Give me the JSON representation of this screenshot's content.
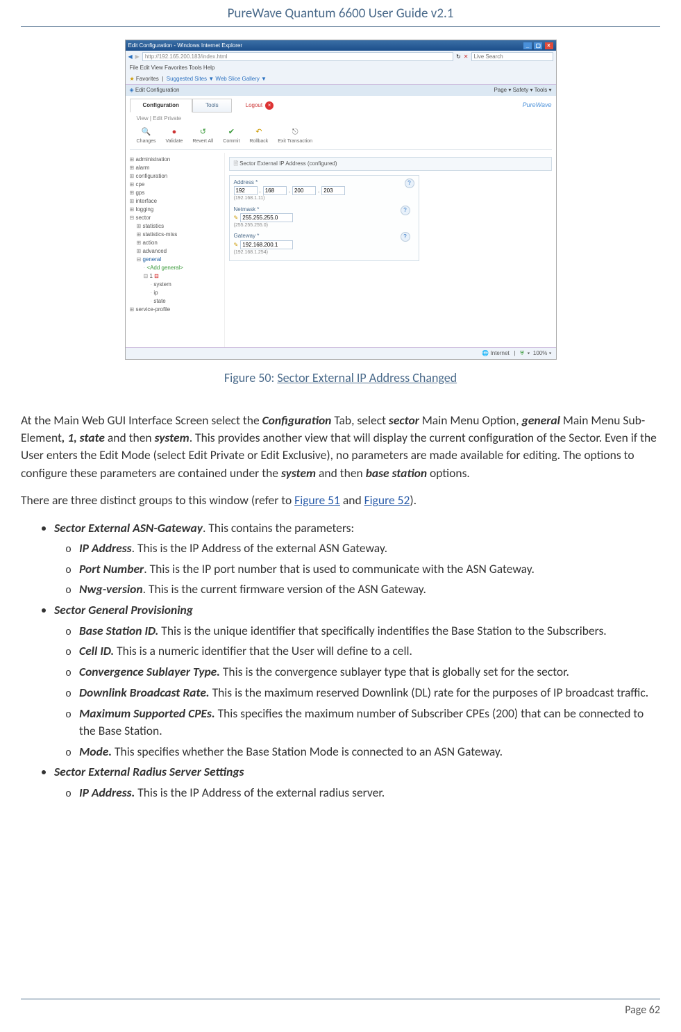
{
  "header": {
    "title": "PureWave Quantum 6600 User Guide v2.1"
  },
  "footer": {
    "page_label": "Page 62"
  },
  "screenshot": {
    "window_title": "Edit Configuration - Windows Internet Explorer",
    "address": "http://192.165.200.183/index.html",
    "search_placeholder": "Live Search",
    "menu": "File   Edit   View   Favorites   Tools   Help",
    "favorites_label": "Favorites",
    "fav_links": "Suggested Sites ▼  Web Slice Gallery ▼",
    "tab_title": "Edit Configuration",
    "tab_tools": "Page ▾ Safety ▾ Tools ▾",
    "tabs": {
      "configuration": "Configuration",
      "tools": "Tools",
      "logout": "Logout"
    },
    "logo": "PureWave",
    "subbar": "View  |  Edit Private",
    "toolbar": [
      {
        "icon": "🔍",
        "label": "Changes",
        "color": "#2a70c0"
      },
      {
        "icon": "●",
        "label": "Validate",
        "color": "#c33"
      },
      {
        "icon": "↺",
        "label": "Revert All",
        "color": "#3a9a3a"
      },
      {
        "icon": "✔",
        "label": "Commit",
        "color": "#3a9a3a"
      },
      {
        "icon": "↶",
        "label": "Rollback",
        "color": "#c90"
      },
      {
        "icon": "⎋",
        "label": "Exit Transaction",
        "color": "#888"
      }
    ],
    "tree": {
      "administration": "administration",
      "alarm": "alarm",
      "configuration": "configuration",
      "cpe": "cpe",
      "gps": "gps",
      "interface": "interface",
      "logging": "logging",
      "sector": "sector",
      "statistics": "statistics",
      "statistics_miss": "statistics-miss",
      "action": "action",
      "advanced": "advanced",
      "general": "general",
      "add_general": "<Add general>",
      "one": "1",
      "system": "system",
      "ip": "ip",
      "state": "state",
      "service_profile": "service-profile"
    },
    "panel_title": "Sector External IP Address (configured)",
    "form": {
      "address_label": "Address *",
      "addr_octets": [
        "192",
        "168",
        "200",
        "203"
      ],
      "addr_hint": "(192.168.1.11)",
      "netmask_label": "Netmask *",
      "netmask_value": "255.255.255.0",
      "netmask_hint": "(255.255.255.0)",
      "gateway_label": "Gateway *",
      "gateway_value": "192.168.200.1",
      "gateway_hint": "(192.168.1.254)"
    },
    "status": {
      "internet": "Internet",
      "zoom": "100%"
    }
  },
  "figure": {
    "prefix": "Figure 50: ",
    "caption": "Sector External IP Address Changed"
  },
  "para1": {
    "t1": "At the Main Web GUI Interface Screen select the ",
    "b1": "Configuration",
    "t2": " Tab, select ",
    "b2": "sector",
    "t3": " Main Menu Option, ",
    "b3": "general",
    "t4": " Main Menu Sub-Element",
    "b4": ", 1, state",
    "t5": " and then ",
    "b5": "system",
    "t6": ". This provides another view that will display the current configuration of the Sector. Even if the User enters the Edit Mode (select Edit Private or Edit Exclusive), no parameters are made available for editing. The options to configure these parameters are contained under the ",
    "b6": "system",
    "t7": " and then ",
    "b7": "base station",
    "t8": " options."
  },
  "para2": {
    "t1": "There are three distinct groups to this window (refer to ",
    "r1": "Figure 51",
    "t2": " and ",
    "r2": "Figure 52",
    "t3": ")."
  },
  "list": {
    "g1": {
      "title": "Sector External ASN-Gateway",
      "tail": ". This contains the parameters:",
      "items": [
        {
          "b": "IP Address",
          "t": ". This is the IP Address of the external ASN Gateway."
        },
        {
          "b": "Port Number",
          "t": ". This is the IP port number that is used to communicate with the ASN Gateway."
        },
        {
          "b": "Nwg-version",
          "t": ". This is the current firmware version of the ASN Gateway."
        }
      ]
    },
    "g2": {
      "title": "Sector General Provisioning",
      "items": [
        {
          "b": "Base Station ID.",
          "t": " This is the unique identifier that specifically indentifies the Base Station to the Subscribers."
        },
        {
          "b": "Cell ID.",
          "t": " This is a numeric identifier that the User will define to a cell."
        },
        {
          "b": "Convergence Sublayer Type.",
          "t": " This is the convergence sublayer type that is globally set for the sector."
        },
        {
          "b": "Downlink Broadcast Rate.",
          "t": " This is the maximum reserved Downlink (DL) rate for the purposes of IP broadcast traffic."
        },
        {
          "b": "Maximum Supported CPEs.",
          "t": " This specifies the maximum number of Subscriber CPEs (200) that can be connected to the Base Station."
        },
        {
          "b": "Mode.",
          "t": " This specifies whether the Base Station Mode is connected to an ASN Gateway."
        }
      ]
    },
    "g3": {
      "title": "Sector External Radius Server Settings",
      "items": [
        {
          "b": "IP Address.",
          "t": " This is the IP Address of the external radius server."
        }
      ]
    }
  }
}
